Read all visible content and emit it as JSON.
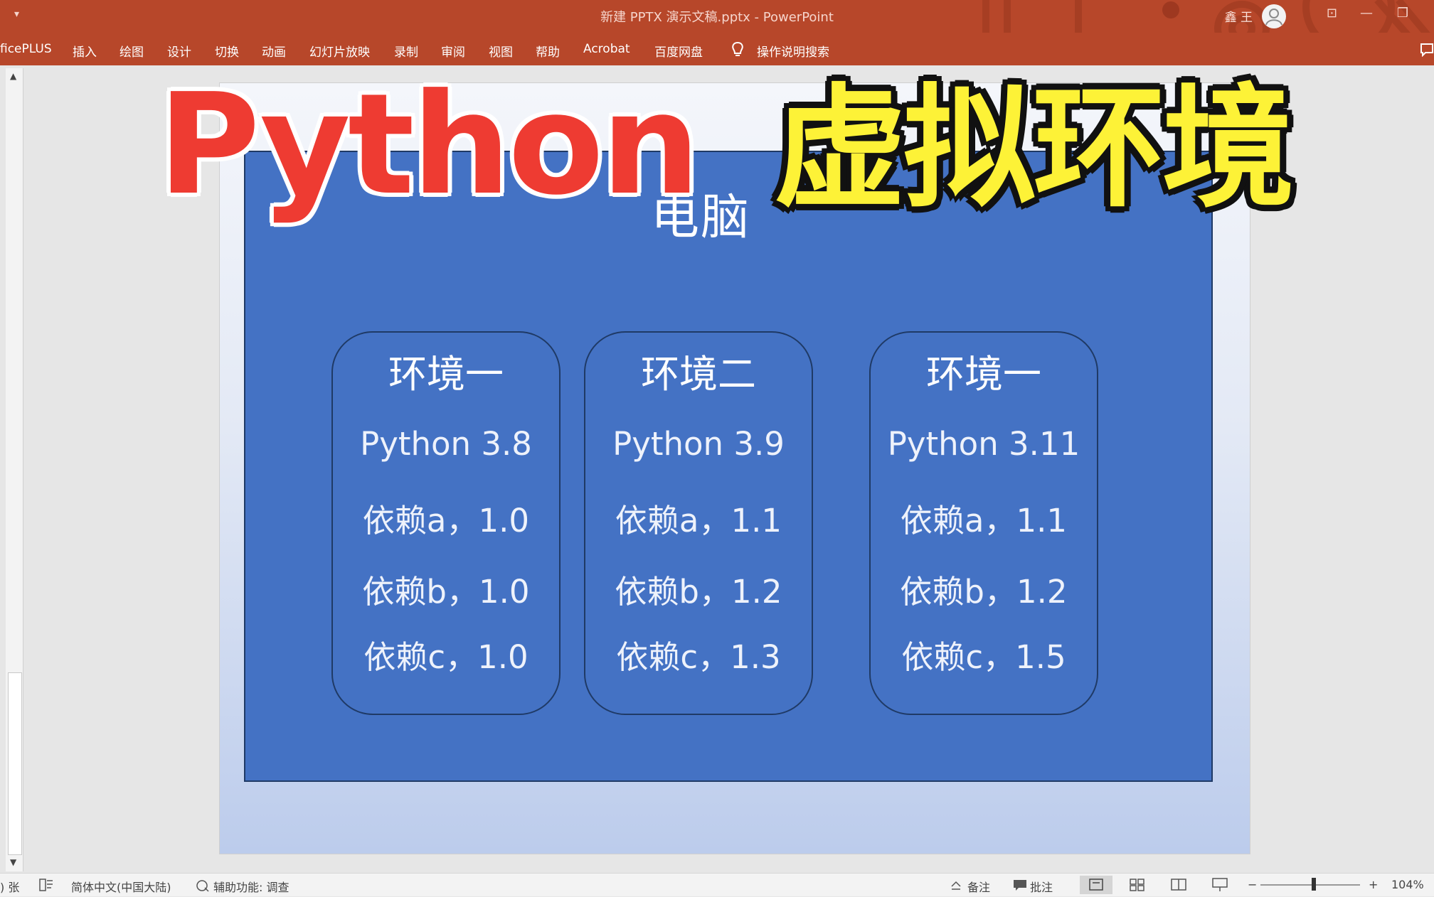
{
  "window": {
    "title": "新建 PPTX 演示文稿.pptx - PowerPoint",
    "quick_access": "▾",
    "user_name": "鑫 王",
    "buttons": {
      "ribbon_display": "⊡",
      "minimize": "—",
      "restore": "❐"
    }
  },
  "ribbon": {
    "tabs": [
      "ficePLUS",
      "插入",
      "绘图",
      "设计",
      "切换",
      "动画",
      "幻灯片放映",
      "录制",
      "审阅",
      "视图",
      "帮助",
      "Acrobat",
      "百度网盘",
      "操作说明搜索"
    ]
  },
  "slide": {
    "title": "电脑",
    "environments": [
      {
        "heading": "环境一",
        "python": "Python 3.8",
        "dep_a": "依赖a，1.0",
        "dep_b": "依赖b，1.0",
        "dep_c": "依赖c，1.0"
      },
      {
        "heading": "环境二",
        "python": "Python 3.9",
        "dep_a": "依赖a，1.1",
        "dep_b": "依赖b，1.2",
        "dep_c": "依赖c，1.3"
      },
      {
        "heading": "环境一",
        "python": "Python 3.11",
        "dep_a": "依赖a，1.1",
        "dep_b": "依赖b，1.2",
        "dep_c": "依赖c，1.5"
      }
    ]
  },
  "overlay": {
    "python_text": "Python",
    "venv_text": "虚拟环境"
  },
  "statusbar": {
    "slide_count": ") 张",
    "language": "简体中文(中国大陆)",
    "accessibility": "辅助功能: 调查",
    "notes": "备注",
    "comments": "批注",
    "zoom_minus": "−",
    "zoom_plus": "+",
    "zoom": "104%"
  },
  "colors": {
    "ribbon": "#b7472a",
    "panel": "#4472c4",
    "python_red": "#ee3b32",
    "venv_yellow": "#fdf237"
  }
}
